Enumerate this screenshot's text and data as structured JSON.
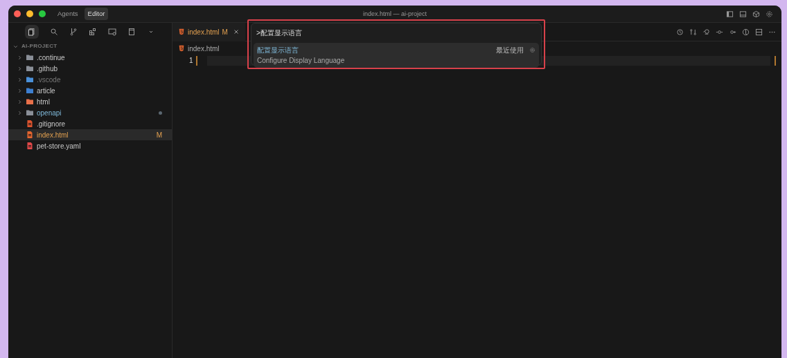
{
  "window": {
    "title": "index.html — ai-project"
  },
  "mode_tabs": [
    {
      "label": "Agents",
      "selected": false
    },
    {
      "label": "Editor",
      "selected": true
    }
  ],
  "sidebar": {
    "section": "AI-PROJECT",
    "expanded": true,
    "items": [
      {
        "label": ".continue",
        "kind": "folder",
        "color": "#8a8f98",
        "selected": false,
        "expanded": false
      },
      {
        "label": ".github",
        "kind": "folder",
        "color": "#8a8f98",
        "selected": false,
        "expanded": false
      },
      {
        "label": ".vscode",
        "kind": "folder",
        "color": "#4a90d9",
        "selected": false,
        "expanded": false,
        "dimmed": true
      },
      {
        "label": "article",
        "kind": "folder",
        "color": "#3d7fd0",
        "selected": false,
        "expanded": false
      },
      {
        "label": "html",
        "kind": "folder",
        "color": "#e8704a",
        "selected": false,
        "expanded": false
      },
      {
        "label": "openapi",
        "kind": "folder",
        "color": "#8a8f98",
        "selected": false,
        "expanded": false,
        "modified_dot": true
      },
      {
        "label": ".gitignore",
        "kind": "file",
        "color": "#e0542e",
        "selected": false
      },
      {
        "label": "index.html",
        "kind": "file",
        "color": "#e4652f",
        "selected": true,
        "badge": "M"
      },
      {
        "label": "pet-store.yaml",
        "kind": "file",
        "color": "#e04848",
        "selected": false
      }
    ]
  },
  "editor": {
    "tab": {
      "label": "index.html",
      "badge": "M"
    },
    "breadcrumb": "index.html",
    "line_numbers": [
      "1"
    ]
  },
  "command_palette": {
    "query": ">配置显示语言",
    "results": [
      {
        "title": "配置显示语言",
        "subtitle": "Configure Display Language",
        "tag": "最近使用",
        "selected": true
      }
    ]
  }
}
